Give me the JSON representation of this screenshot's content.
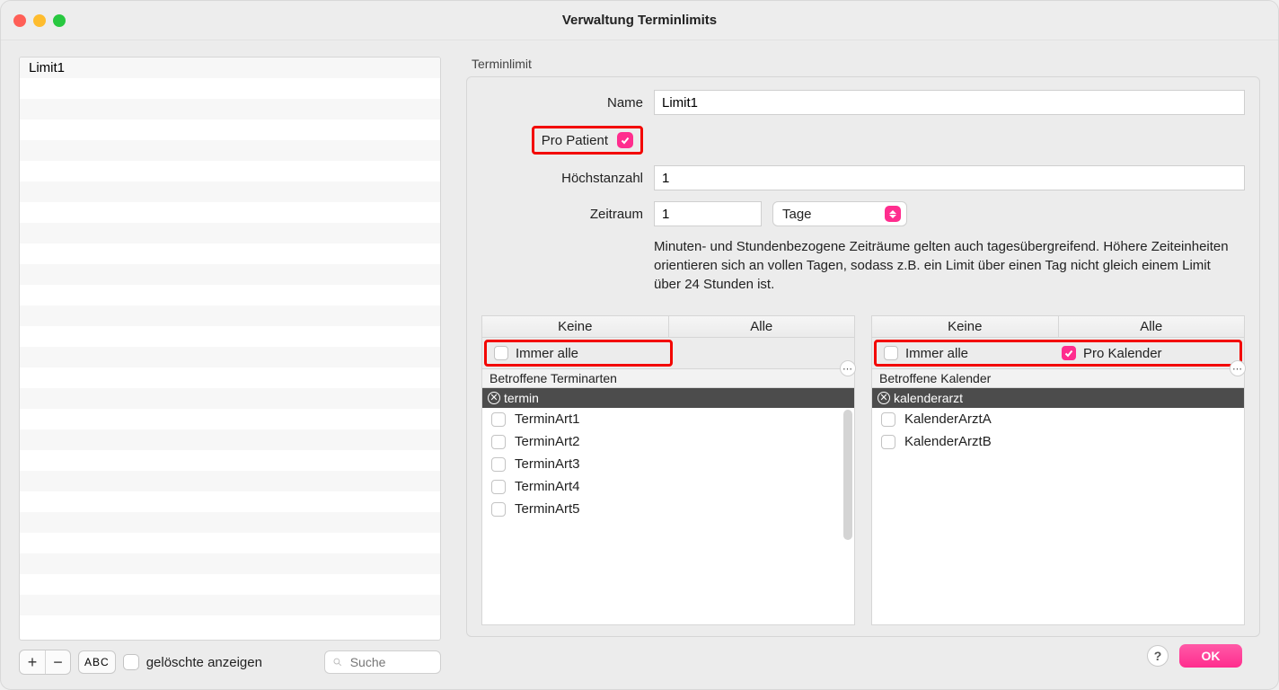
{
  "window": {
    "title": "Verwaltung Terminlimits"
  },
  "sidebar": {
    "items": [
      "Limit1"
    ],
    "selected_index": 0,
    "add_label": "+",
    "remove_label": "−",
    "abc_label": "ABC",
    "show_deleted_label": "gelöschte anzeigen",
    "show_deleted_checked": false,
    "search_placeholder": "Suche"
  },
  "form": {
    "section_label": "Terminlimit",
    "name_label": "Name",
    "name_value": "Limit1",
    "pro_patient_label": "Pro Patient",
    "pro_patient_checked": true,
    "max_label": "Höchstanzahl",
    "max_value": "1",
    "period_label": "Zeitraum",
    "period_value": "1",
    "period_unit": "Tage",
    "hint": "Minuten- und Stundenbezogene Zeiträume gelten auch tagesübergreifend. Höhere Zeiteinheiten orientieren sich an vollen Tagen, sodass z.B. ein Limit über einen Tag nicht gleich einem Limit über 24 Stunden ist."
  },
  "left_col": {
    "hdr_none": "Keine",
    "hdr_all": "Alle",
    "always_all_label": "Immer alle",
    "always_all_checked": false,
    "filter_label": "Betroffene Terminarten",
    "tag": "termin",
    "items": [
      "TerminArt1",
      "TerminArt2",
      "TerminArt3",
      "TerminArt4",
      "TerminArt5"
    ]
  },
  "right_col": {
    "hdr_none": "Keine",
    "hdr_all": "Alle",
    "always_all_label": "Immer alle",
    "always_all_checked": false,
    "pro_kalender_label": "Pro Kalender",
    "pro_kalender_checked": true,
    "filter_label": "Betroffene Kalender",
    "tag": "kalenderarzt",
    "items": [
      "KalenderArztA",
      "KalenderArztB"
    ]
  },
  "footer": {
    "help": "?",
    "ok": "OK"
  }
}
